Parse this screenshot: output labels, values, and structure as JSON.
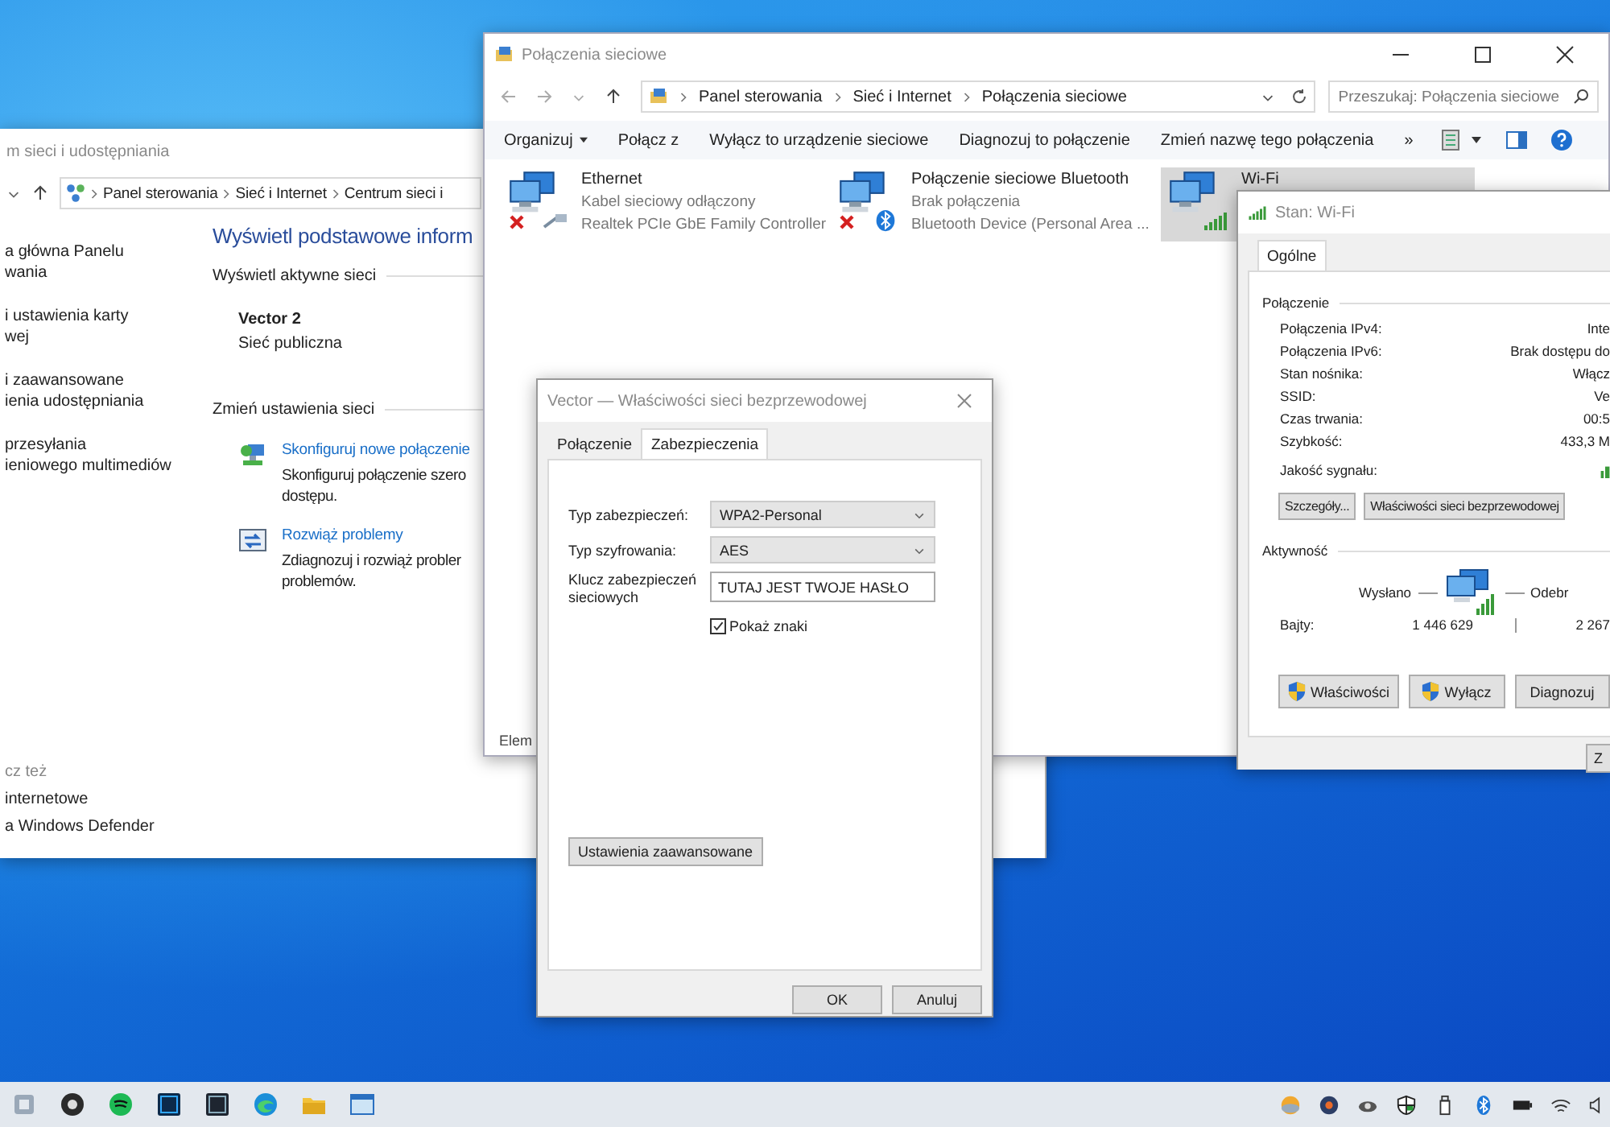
{
  "control_panel": {
    "title": "m sieci i udostępniania",
    "breadcrumb": [
      "Panel sterowania",
      "Sieć i Internet",
      "Centrum sieci i"
    ],
    "sidebar": [
      {
        "lines": [
          "a główna Panelu",
          "wania"
        ]
      },
      {
        "lines": [
          "i ustawienia karty",
          "wej"
        ]
      },
      {
        "lines": [
          "i zaawansowane",
          "ienia udostępniania"
        ]
      },
      {
        "lines": [
          "przesyłania",
          "ieniowego multimediów"
        ]
      }
    ],
    "see_also": {
      "title": "cz też",
      "links": [
        "internetowe",
        "a Windows Defender"
      ]
    },
    "heading": "Wyświetl podstawowe inform",
    "active_networks": {
      "title": "Wyświetl aktywne sieci",
      "name": "Vector 2",
      "type": "Sieć publiczna"
    },
    "change_settings": {
      "title": "Zmień ustawienia sieci",
      "tasks": [
        {
          "kind": "setup",
          "link": "Skonfiguruj nowe połączenie",
          "lines": [
            "Skonfiguruj połączenie szero",
            "dostępu."
          ]
        },
        {
          "kind": "troubleshoot",
          "link": "Rozwiąż problemy",
          "lines": [
            "Zdiagnozuj i rozwiąż probler",
            "problemów."
          ]
        }
      ]
    }
  },
  "network_connections": {
    "title": "Połączenia sieciowe",
    "breadcrumb": [
      "Panel sterowania",
      "Sieć i Internet",
      "Połączenia sieciowe"
    ],
    "search": {
      "placeholder": "Przeszukaj: Połączenia sieciowe"
    },
    "toolbar": [
      {
        "label": "Organizuj",
        "dropdown": true
      },
      {
        "label": "Połącz z",
        "dropdown": false
      },
      {
        "label": "Wyłącz to urządzenie sieciowe",
        "dropdown": false
      },
      {
        "label": "Diagnozuj to połączenie",
        "dropdown": false
      },
      {
        "label": "Zmień nazwę tego połączenia",
        "dropdown": false
      }
    ],
    "overflow": "»",
    "connections": [
      {
        "kind": "ethernet",
        "name": "Ethernet",
        "status": "Kabel sieciowy odłączony",
        "device": "Realtek PCIe GbE Family Controller",
        "error": true,
        "selected": false
      },
      {
        "kind": "bluetooth",
        "name": "Połączenie sieciowe Bluetooth",
        "status": "Brak połączenia",
        "device": "Bluetooth Device (Personal Area ...",
        "error": true,
        "selected": false
      },
      {
        "kind": "wifi",
        "name": "Wi-Fi",
        "error": false,
        "selected": true
      }
    ],
    "status_bar": "Elem"
  },
  "wireless_properties": {
    "title": "Vector — Właściwości sieci bezprzewodowej",
    "tabs": [
      {
        "label": "Połączenie",
        "selected": false
      },
      {
        "label": "Zabezpieczenia",
        "selected": true
      }
    ],
    "security_type": {
      "label": "Typ zabezpieczeń:",
      "value": "WPA2-Personal"
    },
    "encryption_type": {
      "label": "Typ szyfrowania:",
      "value": "AES"
    },
    "key": {
      "label": "Klucz zabezpieczeń sieciowych",
      "value": "TUTAJ JEST TWOJE HASŁO"
    },
    "show_chars": {
      "label": "Pokaż znaki",
      "checked": true
    },
    "advanced_button": "Ustawienia zaawansowane",
    "buttons": [
      "OK",
      "Anuluj"
    ]
  },
  "wifi_status": {
    "title": "Stan: Wi-Fi",
    "tabs": [
      {
        "label": "Ogólne",
        "selected": true
      }
    ],
    "connection": {
      "title": "Połączenie",
      "rows": [
        {
          "label": "Połączenia IPv4:",
          "value": "Inte"
        },
        {
          "label": "Połączenia IPv6:",
          "value": "Brak dostępu do"
        },
        {
          "label": "Stan nośnika:",
          "value": "Włącz"
        },
        {
          "label": "SSID:",
          "value": "Ve"
        },
        {
          "label": "Czas trwania:",
          "value": "00:5"
        },
        {
          "label": "Szybkość:",
          "value": "433,3 M"
        }
      ],
      "signal_label": "Jakość sygnału:",
      "buttons": [
        "Szczegóły...",
        "Właściwości sieci bezprzewodowej"
      ]
    },
    "activity": {
      "title": "Aktywność",
      "sent": "Wysłano",
      "received": "Odebr",
      "bytes_label": "Bajty:",
      "bytes_sent": "1 446 629",
      "bytes_received": "2 267"
    },
    "buttons": [
      {
        "label": "Właściwości",
        "shield": true
      },
      {
        "label": "Wyłącz",
        "shield": true
      },
      {
        "label": "Diagnozuj",
        "shield": false
      }
    ],
    "close_button": "Z"
  }
}
